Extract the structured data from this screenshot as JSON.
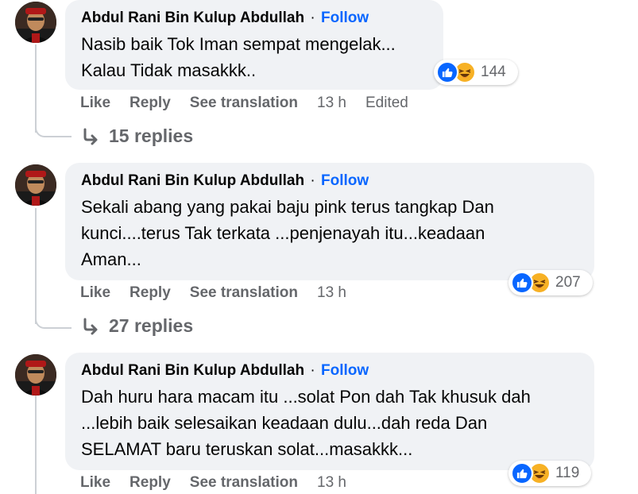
{
  "comments": [
    {
      "author": "Abdul Rani Bin Kulup Abdullah",
      "separator": "·",
      "follow": "Follow",
      "text": "Nasib baik Tok Iman sempat mengelak...\nKalau Tidak masakkk..",
      "reaction_count": "144",
      "actions": {
        "like": "Like",
        "reply": "Reply",
        "translate": "See translation",
        "time": "13 h",
        "edited": "Edited"
      },
      "replies": "15 replies"
    },
    {
      "author": "Abdul Rani Bin Kulup Abdullah",
      "separator": "·",
      "follow": "Follow",
      "text": "Sekali abang yang pakai baju pink terus tangkap Dan\nkunci....terus Tak terkata ...penjenayah itu...keadaan\nAman...",
      "reaction_count": "207",
      "actions": {
        "like": "Like",
        "reply": "Reply",
        "translate": "See translation",
        "time": "13 h"
      },
      "replies": "27 replies"
    },
    {
      "author": "Abdul Rani Bin Kulup Abdullah",
      "separator": "·",
      "follow": "Follow",
      "text": "Dah huru hara macam itu ...solat Pon dah Tak khusuk dah\n...lebih baik selesaikan keadaan dulu...dah reda Dan\nSELAMAT baru teruskan solat...masakkk...",
      "reaction_count": "119",
      "actions": {
        "like": "Like",
        "reply": "Reply",
        "translate": "See translation",
        "time": "13 h"
      }
    }
  ],
  "colors": {
    "follow": "#0866ff",
    "bubble": "#f0f2f5",
    "muted": "#65676b",
    "like": "#0866ff",
    "haha": "#f7b125"
  },
  "icons": {
    "reaction_like": "thumbs-up-icon",
    "reaction_haha": "laughing-face-icon",
    "replies": "reply-arrow-icon"
  }
}
